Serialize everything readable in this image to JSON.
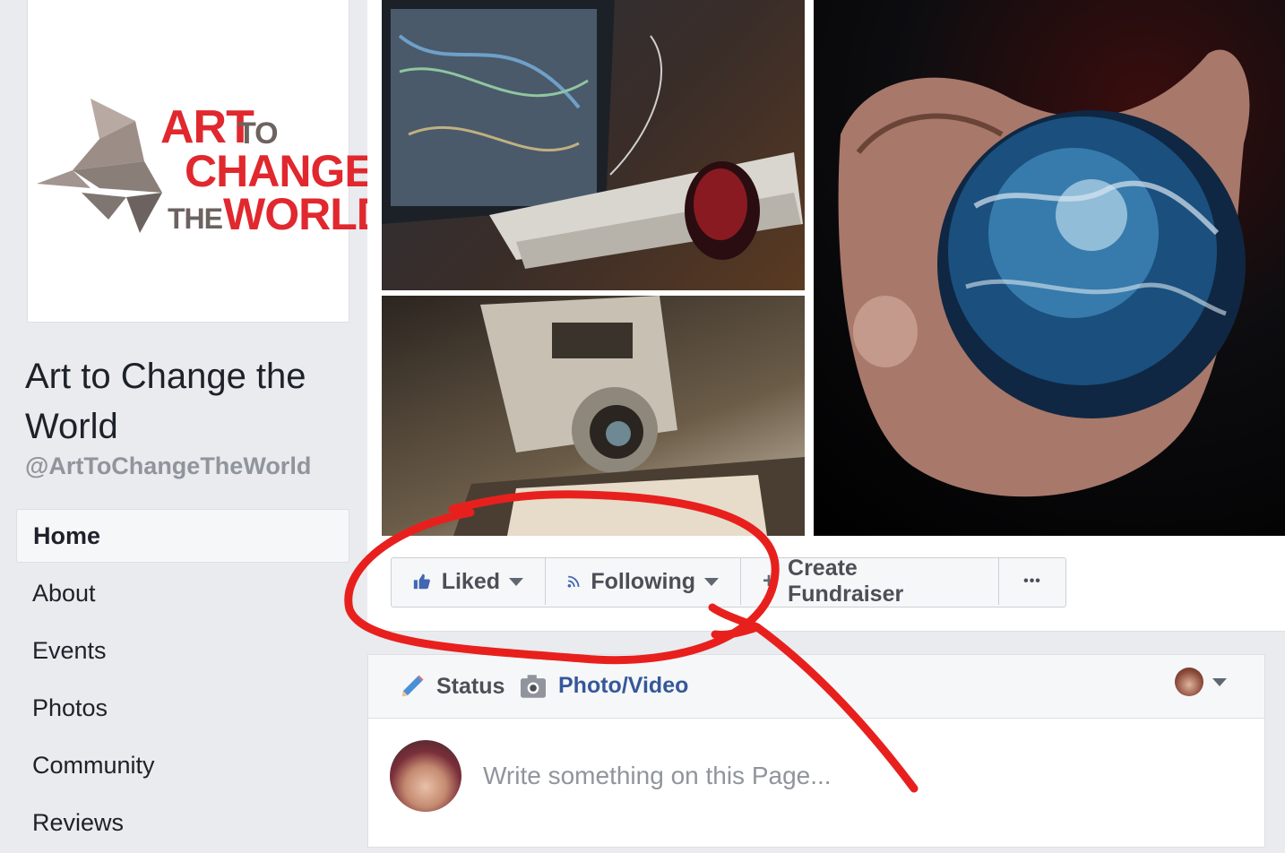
{
  "page": {
    "logo": {
      "line1": "ART",
      "line1b": "TO",
      "line2": "CHANGE",
      "line3a": "THE",
      "line3b": "WORLD"
    },
    "name": "Art to Change the World",
    "handle": "@ArtToChangeTheWorld"
  },
  "nav": {
    "items": [
      {
        "label": "Home",
        "active": true
      },
      {
        "label": "About"
      },
      {
        "label": "Events"
      },
      {
        "label": "Photos"
      },
      {
        "label": "Community"
      },
      {
        "label": "Reviews"
      }
    ]
  },
  "actions": {
    "liked": "Liked",
    "following": "Following",
    "fundraiser": "Create Fundraiser",
    "more": "•••"
  },
  "composer": {
    "status": "Status",
    "photo_video": "Photo/Video",
    "placeholder": "Write something on this Page..."
  },
  "icons": [
    "thumbs-up-icon",
    "rss-icon",
    "plus-icon",
    "more-icon",
    "pencil-icon",
    "camera-icon",
    "chevron-down-icon"
  ],
  "colors": {
    "brand_red": "#e0282e",
    "fb_blue": "#365899",
    "annotation_red": "#e8201d"
  }
}
